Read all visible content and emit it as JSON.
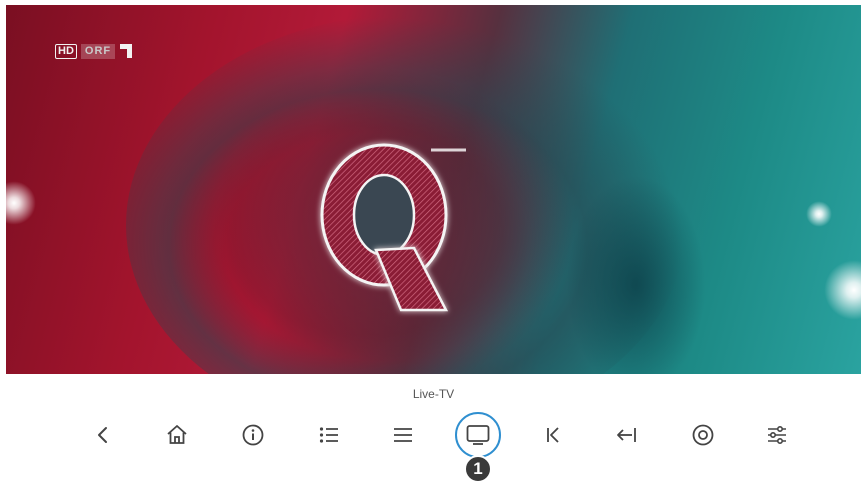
{
  "video": {
    "channel": {
      "hd": "HD",
      "name": "ORF"
    }
  },
  "player": {
    "current_mode_label": "Live-TV",
    "step_badge": "1",
    "accent_color": "#2f8fd0",
    "icon_color": "#444444",
    "buttons": [
      {
        "id": "back",
        "icon": "chevron-left-icon"
      },
      {
        "id": "home",
        "icon": "home-icon"
      },
      {
        "id": "info",
        "icon": "info-icon"
      },
      {
        "id": "list",
        "icon": "bulleted-list-icon"
      },
      {
        "id": "menu",
        "icon": "hamburger-menu-icon"
      },
      {
        "id": "live-tv",
        "icon": "tv-icon",
        "selected": true
      },
      {
        "id": "restart",
        "icon": "skip-to-start-icon"
      },
      {
        "id": "jump-back",
        "icon": "arrow-left-to-bar-icon"
      },
      {
        "id": "record",
        "icon": "record-icon"
      },
      {
        "id": "settings",
        "icon": "sliders-icon"
      }
    ]
  }
}
